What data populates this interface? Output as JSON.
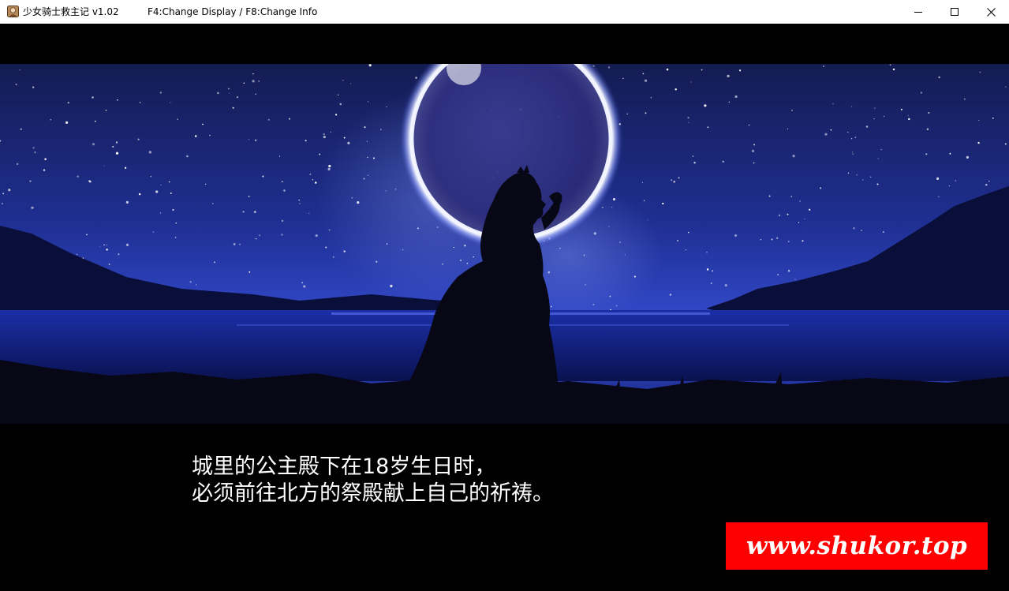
{
  "window": {
    "title": "少女骑士救主记 v1.02",
    "hint": "F4:Change Display / F8:Change Info",
    "controls": {
      "minimize": "minimize-icon",
      "maximize": "maximize-icon",
      "close": "close-icon"
    }
  },
  "scene": {
    "description_icon": "princess-moon-cg",
    "colors": {
      "sky": "#1a2a8a",
      "moon_ring": "#e8ecff",
      "silhouette": "#070716"
    }
  },
  "message": {
    "lines": [
      "城里的公主殿下在18岁生日时，",
      "必须前往北方的祭殿献上自己的祈祷。"
    ]
  },
  "watermark": {
    "text": "www.shukor.top",
    "color": "#ff0000"
  }
}
